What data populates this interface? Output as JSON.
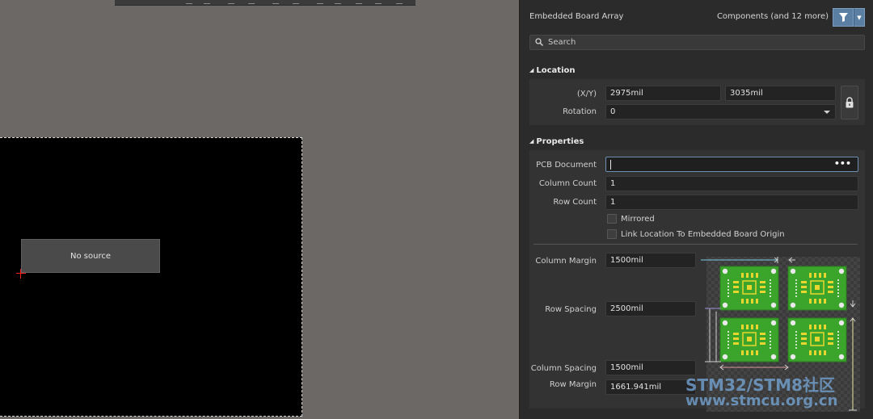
{
  "canvas": {
    "board_label": "No source"
  },
  "panel": {
    "title": "Embedded Board Array",
    "filter_summary": "Components (and 12 more)",
    "search": {
      "placeholder": "Search",
      "value": ""
    },
    "location": {
      "heading": "Location",
      "xy_label": "(X/Y)",
      "x_value": "2975mil",
      "y_value": "3035mil",
      "rotation_label": "Rotation",
      "rotation_value": "0"
    },
    "properties": {
      "heading": "Properties",
      "pcb_document_label": "PCB Document",
      "pcb_document_value": "",
      "column_count_label": "Column Count",
      "column_count_value": "1",
      "row_count_label": "Row Count",
      "row_count_value": "1",
      "mirrored_label": "Mirrored",
      "mirrored_checked": false,
      "link_origin_label": "Link Location To Embedded Board Origin",
      "link_origin_checked": false,
      "column_margin_label": "Column Margin",
      "column_margin_value": "1500mil",
      "row_spacing_label": "Row Spacing",
      "row_spacing_value": "2500mil",
      "column_spacing_label": "Column Spacing",
      "column_spacing_value": "1500mil",
      "row_margin_label": "Row Margin",
      "row_margin_value": "1661.941mil"
    }
  },
  "watermark": {
    "line1": "STM32/STM8社区",
    "line2": "www.stmcu.org.cn"
  },
  "colors": {
    "panel_bg": "#2b2b2b",
    "canvas_bg": "#6b6866",
    "accent_button": "#5b7fa3",
    "board_green": "#3aa52a",
    "pad_yellow": "#e8d630"
  }
}
